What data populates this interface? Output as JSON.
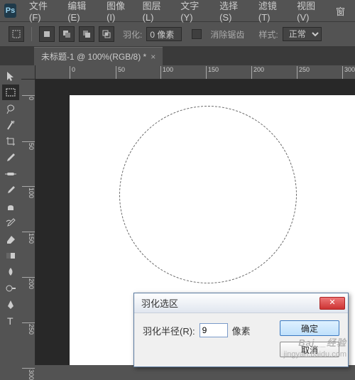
{
  "app": {
    "logo_text": "Ps"
  },
  "menu": {
    "file": "文件(F)",
    "edit": "编辑(E)",
    "image": "图像(I)",
    "layer": "图层(L)",
    "type": "文字(Y)",
    "select": "选择(S)",
    "filter": "滤镜(T)",
    "view": "视图(V)",
    "window": "窗"
  },
  "optbar": {
    "feather_label": "羽化:",
    "feather_value": "0 像素",
    "antialias_label": "消除锯齿",
    "style_label": "样式:",
    "style_value": "正常"
  },
  "tab": {
    "title": "未标题-1 @ 100%(RGB/8) *",
    "close": "×"
  },
  "ruler": {
    "h_ticks": [
      {
        "pos": 0,
        "label": "0"
      },
      {
        "pos": 65,
        "label": "50"
      },
      {
        "pos": 128,
        "label": "100"
      },
      {
        "pos": 192,
        "label": "150"
      },
      {
        "pos": 256,
        "label": "200"
      },
      {
        "pos": 320,
        "label": "250"
      },
      {
        "pos": 384,
        "label": "300"
      }
    ],
    "v_ticks": [
      {
        "pos": 0,
        "label": "0"
      },
      {
        "pos": 65,
        "label": "50"
      },
      {
        "pos": 128,
        "label": "100"
      },
      {
        "pos": 192,
        "label": "150"
      },
      {
        "pos": 256,
        "label": "200"
      },
      {
        "pos": 320,
        "label": "250"
      },
      {
        "pos": 384,
        "label": "300"
      }
    ]
  },
  "dialog": {
    "title": "羽化选区",
    "radius_label": "羽化半径(R):",
    "radius_value": "9",
    "unit": "像素",
    "ok": "确定",
    "cancel": "取消",
    "close_glyph": "✕"
  },
  "watermark": {
    "line1": "Bai__经验",
    "line2": "jingyan.baidu.com"
  }
}
